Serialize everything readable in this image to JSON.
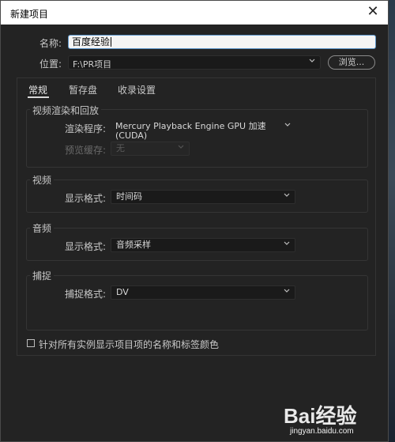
{
  "window": {
    "title": "新建项目",
    "close_glyph": "✕"
  },
  "name_field": {
    "label": "名称:",
    "value": "百度经验"
  },
  "location_field": {
    "label": "位置:",
    "value": "F:\\PR项目",
    "browse_label": "浏览..."
  },
  "tabs": [
    {
      "label": "常规",
      "active": true
    },
    {
      "label": "暂存盘",
      "active": false
    },
    {
      "label": "收录设置",
      "active": false
    }
  ],
  "render_group": {
    "title": "视频渲染和回放",
    "renderer_label": "渲染程序:",
    "renderer_value": "Mercury Playback Engine GPU 加速 (CUDA)",
    "preview_cache_label": "预览缓存:",
    "preview_cache_value": "无"
  },
  "video_group": {
    "title": "视频",
    "format_label": "显示格式:",
    "format_value": "时间码"
  },
  "audio_group": {
    "title": "音频",
    "format_label": "显示格式:",
    "format_value": "音频采样"
  },
  "capture_group": {
    "title": "捕捉",
    "format_label": "捕捉格式:",
    "format_value": "DV"
  },
  "checkbox": {
    "label": "针对所有实例显示项目项的名称和标签颜色",
    "checked": false
  },
  "watermark": {
    "brand": "Bai经验",
    "url": "jingyan.baidu.com"
  }
}
